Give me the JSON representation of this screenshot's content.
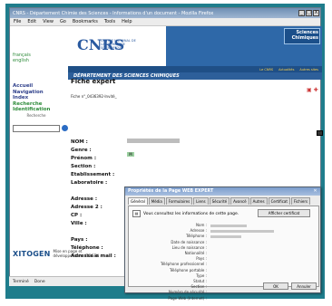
{
  "window": {
    "title": "CNRS - Département Chimie des Sciences - Informations d'un document - Mozilla Firefox",
    "controls": [
      "_",
      "□",
      "X"
    ]
  },
  "menubar": [
    "File",
    "Edit",
    "View",
    "Go",
    "Bookmarks",
    "Tools",
    "Help"
  ],
  "left": {
    "languages": [
      "français",
      "english"
    ],
    "nav": [
      "Accueil",
      "Navigation",
      "Index",
      "Recherche",
      "Identification"
    ],
    "search_label": "Recherche"
  },
  "header": {
    "logo_text": "CNRS",
    "cnrs_caption": "CENTRE NATIONAL DE LA RECHERCHE SCIENTIFIQUE",
    "banner_label": "Sciences Chimiques",
    "navbar": [
      "Le CNRS",
      "Actualités",
      "Autres sites"
    ],
    "department": "DÉPARTEMENT DES SCIENCES CHIMIQUES"
  },
  "page": {
    "title": "Fiche expert",
    "subtitle": "Fiche n°_0436392-Invité_",
    "fields": [
      "NOM :",
      "Genre :",
      "Prénom :",
      "Section :",
      "Etablissement :",
      "Laboratoire :",
      "",
      "Adresse :",
      "Adresse 2 :",
      "CP :",
      "Ville :",
      "",
      "Pays :",
      "Téléphone :",
      "Adresse e mail :"
    ],
    "genre_value": "M",
    "footer_logo": "XITOGEN",
    "footer_text": "Mise en page et développement : ITOGEN"
  },
  "status": {
    "left": "Terminé",
    "right": "Done"
  },
  "dialog": {
    "title": "Propriétés de la Page WEB EXPERT",
    "tabs": [
      "Général",
      "Média",
      "Formulaires",
      "Liens",
      "Sécurité",
      "Avancé",
      "Autres",
      "Certificat",
      "Fichiers"
    ],
    "mainframe_text": "Vous consultez les informations de cette page.",
    "mainframe_button": "Afficher certificat",
    "labels": [
      "Nom :",
      "Adresse :",
      "Téléphone :",
      "Date de naissance :",
      "Lieu de naissance :",
      "Nationalité :",
      "Pays :",
      "Téléphone professionnel :",
      "Téléphone portable :",
      "Type :",
      "Statut :",
      "Section :",
      "Numéro de sécurité :",
      "Page Web (Internet) :"
    ],
    "values": [
      "",
      "",
      "",
      "",
      "",
      "",
      "",
      "",
      "",
      "",
      "",
      "",
      "",
      ""
    ],
    "buttons": [
      "OK",
      "Annuler"
    ]
  }
}
